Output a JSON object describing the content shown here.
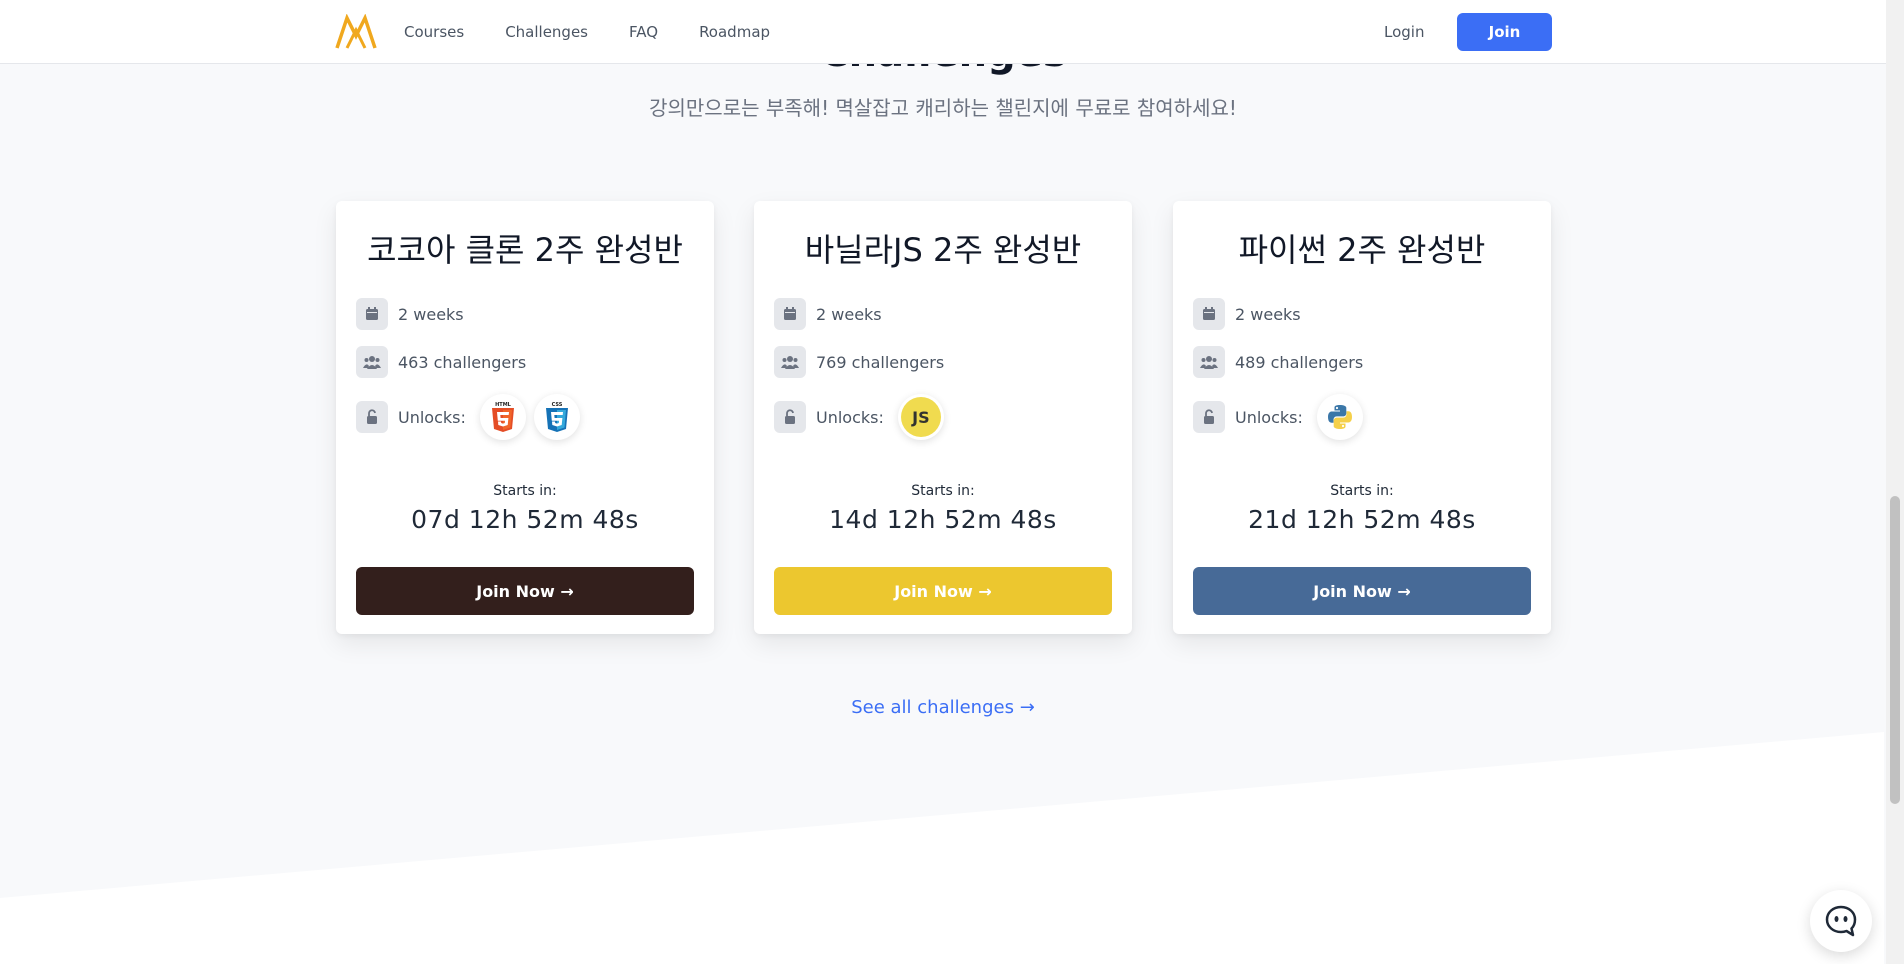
{
  "header": {
    "nav": [
      "Courses",
      "Challenges",
      "FAQ",
      "Roadmap"
    ],
    "login_label": "Login",
    "join_label": "Join",
    "accent": "#3b6ef5"
  },
  "section": {
    "title": "Challenges",
    "subtitle": "강의만으로는 부족해! 멱살잡고 캐리하는 챌린지에 무료로 참여하세요!"
  },
  "cards": [
    {
      "title": "코코아 클론 2주 완성반",
      "duration": "2 weeks",
      "challengers": "463 challengers",
      "unlocks_label": "Unlocks:",
      "unlocks": [
        "html5-icon",
        "css3-icon"
      ],
      "starts_label": "Starts in:",
      "countdown": "07d 12h 52m 48s",
      "button": "Join Now →",
      "button_color": "#331f1c"
    },
    {
      "title": "바닐라JS 2주 완성반",
      "duration": "2 weeks",
      "challengers": "769 challengers",
      "unlocks_label": "Unlocks:",
      "unlocks": [
        "js-icon"
      ],
      "js_label": "JS",
      "starts_label": "Starts in:",
      "countdown": "14d 12h 52m 48s",
      "button": "Join Now →",
      "button_color": "#ecc72f"
    },
    {
      "title": "파이썬 2주 완성반",
      "duration": "2 weeks",
      "challengers": "489 challengers",
      "unlocks_label": "Unlocks:",
      "unlocks": [
        "python-icon"
      ],
      "starts_label": "Starts in:",
      "countdown": "21d 12h 52m 48s",
      "button": "Join Now →",
      "button_color": "#476a97"
    }
  ],
  "see_all_label": "See all challenges →"
}
